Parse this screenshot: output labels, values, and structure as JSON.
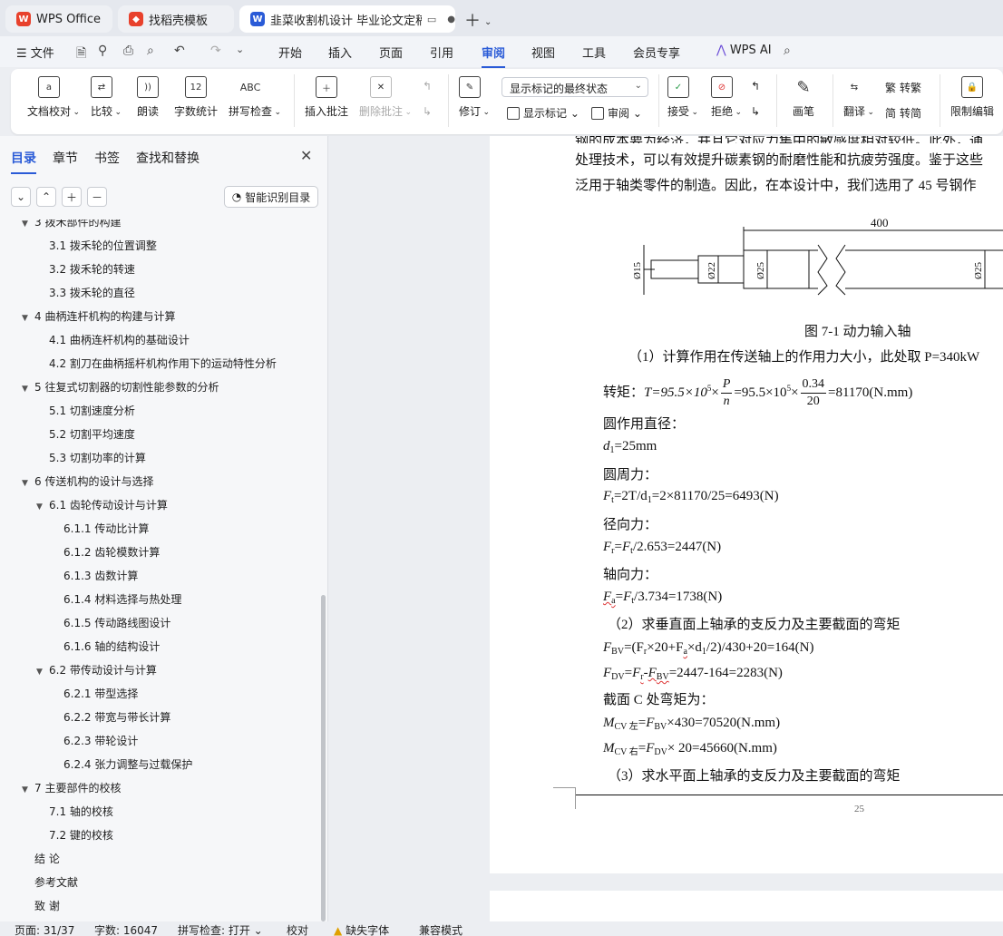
{
  "tabs": [
    {
      "label": "WPS Office",
      "icon": "wps-logo-icon",
      "color": "#e8412c"
    },
    {
      "label": "找稻壳模板",
      "icon": "docer-icon",
      "color": "#e8412c"
    },
    {
      "label": "韭菜收割机设计 毕业论文定稿",
      "icon": "word-doc-icon",
      "color": "#2a5bd7"
    }
  ],
  "menu": {
    "file": "文件",
    "items": [
      "开始",
      "插入",
      "页面",
      "引用",
      "审阅",
      "视图",
      "工具",
      "会员专享"
    ],
    "active": "审阅",
    "wps_ai": "WPS AI"
  },
  "ribbon": {
    "doc_check": "文档校对",
    "compare": "比较",
    "read_aloud": "朗读",
    "word_count": "字数统计",
    "word_count_icon_text": "12",
    "spell_check": "拼写检查",
    "spell_icon_text": "ABC",
    "insert_comment": "插入批注",
    "delete_comment": "删除批注",
    "revise": "修订",
    "markup_select": "显示标记的最终状态",
    "show_markup": "显示标记",
    "review": "审阅",
    "accept": "接受",
    "reject": "拒绝",
    "pen": "画笔",
    "translate": "翻译",
    "to_traditional": "转繁",
    "to_simplified": "转简",
    "restrict_edit": "限制编辑"
  },
  "sidebar": {
    "tabs": [
      "目录",
      "章节",
      "书签",
      "查找和替换"
    ],
    "smart_button": "智能识别目录",
    "toc": [
      {
        "text": "3  拨禾部件的构建",
        "level": 1,
        "arrow": "▼"
      },
      {
        "text": "3.1 拨禾轮的位置调整",
        "level": 2,
        "arrow": ""
      },
      {
        "text": "3.2 拨禾轮的转速",
        "level": 2,
        "arrow": ""
      },
      {
        "text": "3.3  拨禾轮的直径",
        "level": 2,
        "arrow": ""
      },
      {
        "text": "4  曲柄连杆机构的构建与计算",
        "level": 1,
        "arrow": "▼"
      },
      {
        "text": "4.1  曲柄连杆机构的基础设计",
        "level": 2,
        "arrow": ""
      },
      {
        "text": "4.2  割刀在曲柄摇杆机构作用下的运动特性分析",
        "level": 2,
        "arrow": ""
      },
      {
        "text": "5  往复式切割器的切割性能参数的分析",
        "level": 1,
        "arrow": "▼"
      },
      {
        "text": "5.1 切割速度分析",
        "level": 2,
        "arrow": ""
      },
      {
        "text": "5.2 切割平均速度",
        "level": 2,
        "arrow": ""
      },
      {
        "text": "5.3 切割功率的计算",
        "level": 2,
        "arrow": ""
      },
      {
        "text": "6  传送机构的设计与选择",
        "level": 1,
        "arrow": "▼"
      },
      {
        "text": "6.1  齿轮传动设计与计算",
        "level": 2,
        "arrow": "▼"
      },
      {
        "text": "6.1.1  传动比计算",
        "level": 3,
        "arrow": ""
      },
      {
        "text": "6.1.2  齿轮模数计算",
        "level": 3,
        "arrow": ""
      },
      {
        "text": "6.1.3  齿数计算",
        "level": 3,
        "arrow": ""
      },
      {
        "text": "6.1.4  材料选择与热处理",
        "level": 3,
        "arrow": ""
      },
      {
        "text": "6.1.5  传动路线图设计",
        "level": 3,
        "arrow": ""
      },
      {
        "text": "6.1.6  轴的结构设计",
        "level": 3,
        "arrow": ""
      },
      {
        "text": "6.2  带传动设计与计算",
        "level": 2,
        "arrow": "▼"
      },
      {
        "text": "6.2.1  带型选择",
        "level": 3,
        "arrow": ""
      },
      {
        "text": "6.2.2  带宽与带长计算",
        "level": 3,
        "arrow": ""
      },
      {
        "text": "6.2.3  带轮设计",
        "level": 3,
        "arrow": ""
      },
      {
        "text": "6.2.4  张力调整与过载保护",
        "level": 3,
        "arrow": ""
      },
      {
        "text": "7  主要部件的校核",
        "level": 1,
        "arrow": "▼"
      },
      {
        "text": "7.1 轴的校核",
        "level": 2,
        "arrow": ""
      },
      {
        "text": "7.2 键的校核",
        "level": 2,
        "arrow": ""
      },
      {
        "text": "结    论",
        "level": 1,
        "arrow": ""
      },
      {
        "text": "参考文献",
        "level": 1,
        "arrow": ""
      },
      {
        "text": "致    谢",
        "level": 1,
        "arrow": ""
      }
    ]
  },
  "document": {
    "line_top": "钢的成本要为经济，并且它对应力集中的敏感度相对较低。此外，通",
    "line1": "处理技术，可以有效提升碳素钢的耐磨性能和抗疲劳强度。鉴于这些",
    "line2": "泛用于轴类零件的制造。因此，在本设计中，我们选用了 45 号钢作",
    "drawing": {
      "dim_400": "400",
      "d15": "Ø15",
      "d22": "Ø22",
      "d25a": "Ø25",
      "d25b": "Ø25"
    },
    "figure_caption": "图 7-1  动力输入轴",
    "step1": "（1）计算作用在传送轴上的作用力大小，此处取 P=340kW",
    "torque_label": "转矩：",
    "torque_eq1": "T=95.5×10",
    "torque_exp": "5",
    "torque_times": "×",
    "torque_frac_num": "P",
    "torque_frac_den": "n",
    "torque_eq2": "=95.5×10",
    "torque_frac2_num": "0.34",
    "torque_frac2_den": "20",
    "torque_result": "=81170(N.mm)",
    "circle_dia_label": "圆作用直径：",
    "d1_eq": "=25mm",
    "circ_force_label": "圆周力：",
    "ft_eq": "=2T/d",
    "ft_result": "=2×81170/25=6493(N)",
    "radial_label": "径向力：",
    "fr_result": "/2.653=2447(N)",
    "axial_label": "轴向力：",
    "fa_result": "/3.734=1738(N)",
    "step2": "（2）求垂直面上轴承的支反力及主要截面的弯矩",
    "fbv_eq": "=(F",
    "fbv_mid": "×20+F",
    "fbv_mid2": "×d",
    "fbv_result": "/2)/430+20=164(N)",
    "fdv_result": "=2447-164=2283(N)",
    "section_c": "截面 C 处弯矩为：",
    "mcv1_result": "×430=70520(N.mm)",
    "mcv2_result": "× 20=45660(N.mm)",
    "step3": "（3）求水平面上轴承的支反力及主要截面的弯矩",
    "page_number": "25"
  },
  "statusbar": {
    "page": "页面: 31/37",
    "words": "字数: 16047",
    "spell": "拼写检查: 打开",
    "proof": "校对",
    "missing_font": "缺失字体",
    "compat": "兼容模式"
  }
}
